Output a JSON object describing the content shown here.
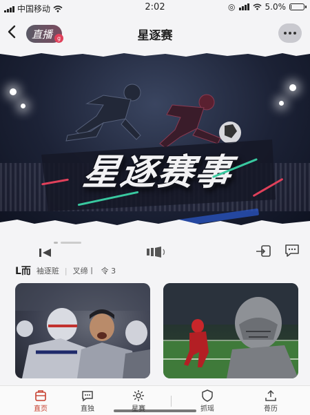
{
  "status_bar": {
    "carrier": "中国移动",
    "time": "2:02",
    "battery": "5.0%",
    "battery_level": 0.05
  },
  "header": {
    "live_label": "直播",
    "live_badge_glyph": "g",
    "title": "星逐赛"
  },
  "banner": {
    "title": "星逐赛事"
  },
  "tag_row": {
    "lead": "L而",
    "tags": [
      "袖逐赃",
      "叉缔丨",
      "令 3"
    ]
  },
  "icons": {
    "back": "chevron-left-icon",
    "more": "more-dots-icon",
    "action_left": "rewind-icon",
    "action_center": "speaker-icon",
    "share": "share-icon",
    "comment": "comment-icon"
  },
  "tabs": [
    {
      "label": "直页",
      "icon": "home-icon",
      "active": true
    },
    {
      "label": "直独",
      "icon": "message-icon",
      "active": false
    },
    {
      "label": "星赛",
      "icon": "gear-icon",
      "active": false
    },
    {
      "label": "抓瑶",
      "icon": "shield-icon",
      "active": false
    },
    {
      "label": "蓇历",
      "icon": "upload-icon",
      "active": false
    }
  ],
  "colors": {
    "accent": "#c7402f",
    "banner_dark": "#1c2236",
    "streak_green": "#39c9a0",
    "streak_red": "#e0405a"
  }
}
